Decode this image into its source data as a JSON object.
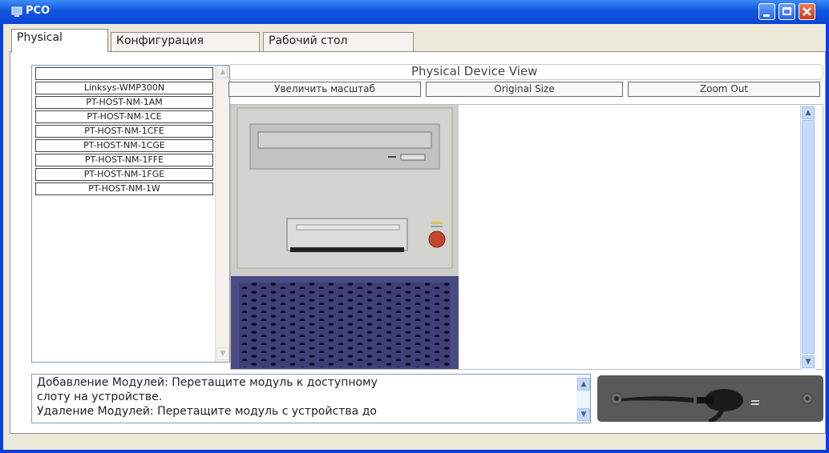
{
  "window": {
    "title": "PCO"
  },
  "tabs": [
    {
      "label": "Physical",
      "active": true
    },
    {
      "label": "Конфигурация",
      "active": false
    },
    {
      "label": "Рабочий стол",
      "active": false
    }
  ],
  "modules": {
    "items": [
      "",
      "Linksys-WMP300N",
      "PT-HOST-NM-1AM",
      "PT-HOST-NM-1CE",
      "PT-HOST-NM-1CFE",
      "PT-HOST-NM-1CGE",
      "PT-HOST-NM-1FFE",
      "PT-HOST-NM-1FGE",
      "PT-HOST-NM-1W"
    ]
  },
  "physical_view": {
    "title": "Physical Device View",
    "zoom_in_label": "Увеличить масштаб",
    "original_size_label": "Original Size",
    "zoom_out_label": "Zoom Out"
  },
  "info": {
    "lines": [
      "Добавление Модулей: Перетащите модуль к доступному",
      "слоту на устройстве.",
      "Удаление Модулей: Перетащите модуль с устройства до"
    ]
  },
  "colors": {
    "titlebar": "#0a46d4",
    "tower_panel": "#cfcfcb",
    "tower_base": "#4c4c8a",
    "power_button": "#c44530"
  }
}
